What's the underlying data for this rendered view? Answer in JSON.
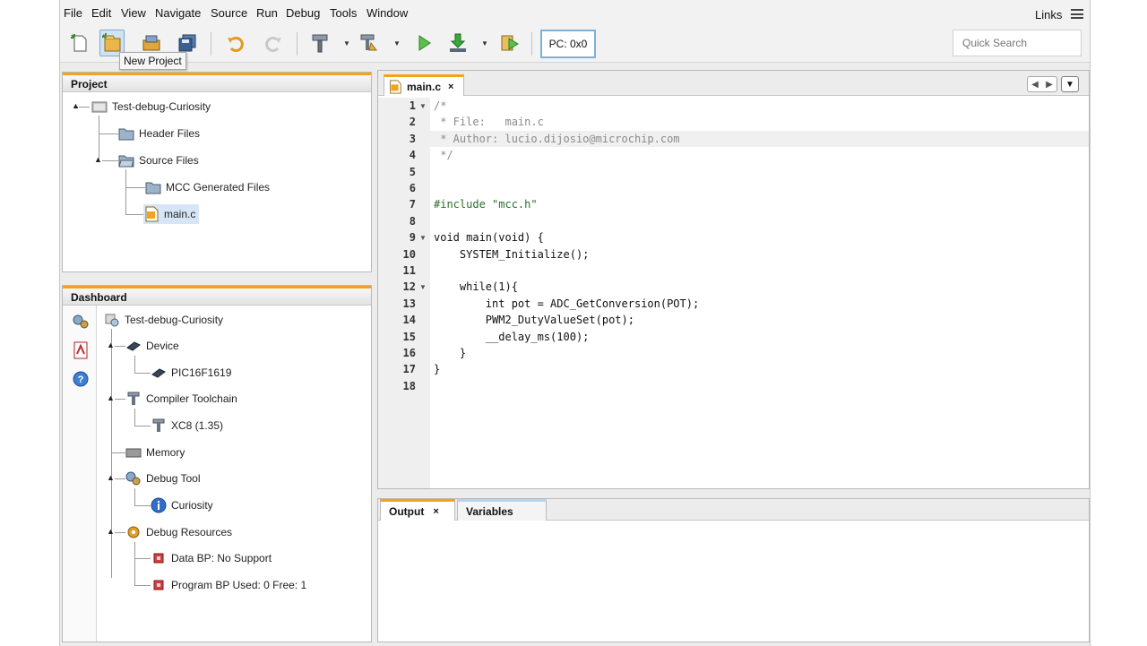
{
  "menu": [
    "File",
    "Edit",
    "View",
    "Navigate",
    "Source",
    "Run",
    "Debug",
    "Tools",
    "Window"
  ],
  "links_label": "Links",
  "toolbar": {
    "pc_label": "PC: 0x0",
    "search_placeholder": "Quick Search",
    "tooltip": "New Project"
  },
  "project": {
    "title": "Project",
    "root": "Test-debug-Curiosity",
    "header_files": "Header Files",
    "source_files": "Source Files",
    "mcc_generated": "MCC Generated Files",
    "main_file": "main.c"
  },
  "dashboard": {
    "title": "Dashboard",
    "root": "Test-debug-Curiosity",
    "device": "Device",
    "device_name": "PIC16F1619",
    "compiler": "Compiler Toolchain",
    "compiler_name": "XC8 (1.35)",
    "memory": "Memory",
    "debug_tool": "Debug Tool",
    "debug_tool_name": "Curiosity",
    "debug_resources": "Debug Resources",
    "data_bp": "Data BP: No Support",
    "program_bp": "Program BP Used: 0 Free: 1"
  },
  "editor": {
    "tab_label": "main.c",
    "line_numbers": [
      "1",
      "2",
      "3",
      "4",
      "5",
      "6",
      "7",
      "8",
      "9",
      "10",
      "11",
      "12",
      "13",
      "14",
      "15",
      "16",
      "17",
      "18"
    ],
    "lines": [
      "/*",
      " * File:   main.c",
      " * Author: lucio.dijosio@microchip.com",
      " */",
      "",
      "",
      "#include \"mcc.h\"",
      "",
      "void main(void) {",
      "    SYSTEM_Initialize();",
      "",
      "    while(1){",
      "        int pot = ADC_GetConversion(POT);",
      "        PWM2_DutyValueSet(pot);",
      "        __delay_ms(100);",
      "    }",
      "}",
      ""
    ]
  },
  "output": {
    "tab_output": "Output",
    "tab_variables": "Variables"
  },
  "colors": {
    "accent_orange": "#f2a31a",
    "selection_blue": "#d7e6f7",
    "comment_gray": "#8a8a8a"
  }
}
